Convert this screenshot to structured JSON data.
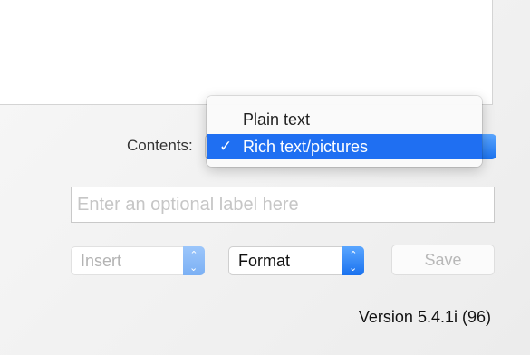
{
  "contents": {
    "label": "Contents:",
    "options": [
      "Plain text",
      "Rich text/pictures"
    ],
    "selected": "Rich text/pictures",
    "check_mark": "✓"
  },
  "label_field": {
    "placeholder": "Enter an optional label here",
    "value": ""
  },
  "toolbar": {
    "insert_label": "Insert",
    "format_label": "Format",
    "save_label": "Save"
  },
  "version_text": "Version 5.4.1i (96)",
  "colors": {
    "accent": "#1f6ff2",
    "disabled_text": "#b8b8b8"
  },
  "icons": {
    "stepper": "up-down-chevron-icon",
    "check": "checkmark-icon"
  }
}
